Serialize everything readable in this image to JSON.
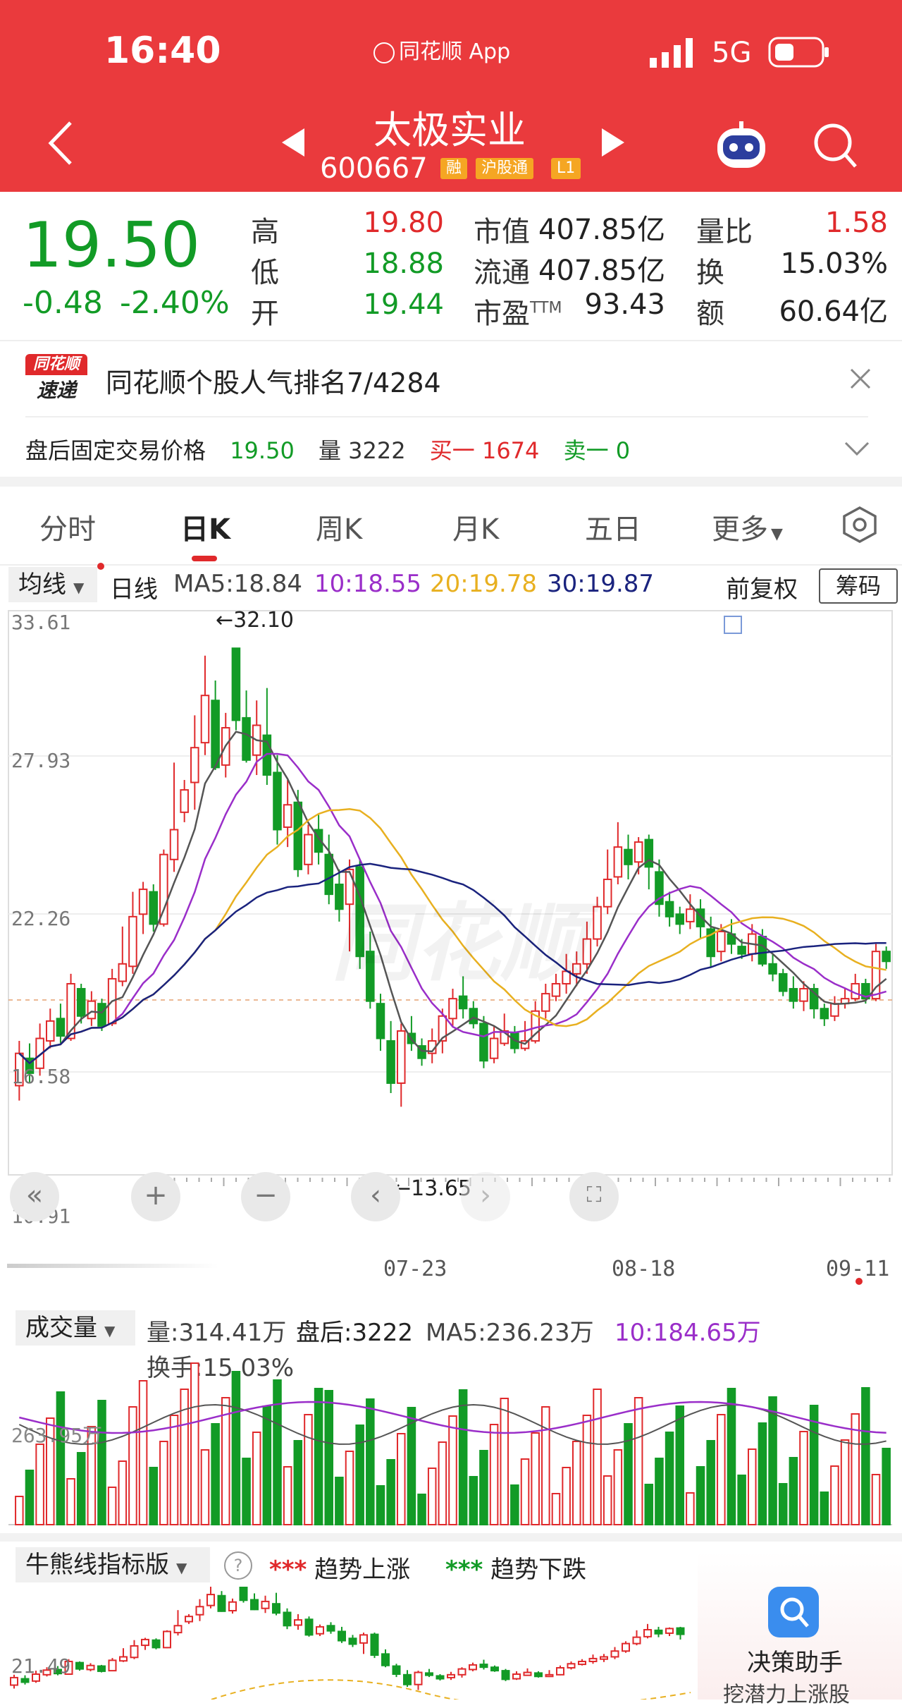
{
  "status_bar": {
    "time": "16:40",
    "app_label": "同花顺 App",
    "network": "5G"
  },
  "header": {
    "title": "太极实业",
    "code": "600667",
    "tags": [
      "融",
      "沪股通",
      "L1"
    ]
  },
  "quote": {
    "price": "19.50",
    "change": "-0.48",
    "change_pct": "-2.40%",
    "stats": [
      {
        "label": "高",
        "value": "19.80"
      },
      {
        "label": "低",
        "value": "18.88"
      },
      {
        "label": "开",
        "value": "19.44"
      },
      {
        "label": "市值",
        "value": "407.85亿"
      },
      {
        "label": "流通",
        "value": "407.85亿"
      },
      {
        "label": "市盈",
        "label_sup": "TTM",
        "value": "93.43"
      },
      {
        "label": "量比",
        "value": "1.58"
      },
      {
        "label": "换",
        "value": "15.03%"
      },
      {
        "label": "额",
        "value": "60.64亿"
      }
    ]
  },
  "news": {
    "logo_top": "同花顺",
    "logo_bottom": "速递",
    "text": "同花顺个股人气排名7/4284"
  },
  "after_hours": {
    "label": "盘后固定交易价格",
    "price": "19.50",
    "vol_label": "量",
    "vol": "3222",
    "buy_label": "买一",
    "buy": "1674",
    "sell_label": "卖一",
    "sell": "0"
  },
  "tabs": [
    "分时",
    "日K",
    "周K",
    "月K",
    "五日",
    "更多"
  ],
  "active_tab": "日K",
  "ma_bar": {
    "selector": "均线",
    "period": "日线",
    "ma5": "MA5:18.84",
    "ma10": "10:18.55",
    "ma20": "20:19.78",
    "ma30": "30:19.87",
    "adjust": "前复权",
    "chips": "筹码"
  },
  "kline": {
    "y_labels": [
      "33.61",
      "27.93",
      "22.26",
      "16.58",
      "10.91"
    ],
    "high_label": "←32.10",
    "low_label": "←13.65",
    "x_labels": [
      "07-23",
      "08-18",
      "09-11"
    ],
    "watermark": "同花顺"
  },
  "volume": {
    "selector": "成交量",
    "vol": "量:314.41万",
    "after": "盘后:3222",
    "ma5": "MA5:236.23万",
    "ma10": "10:184.65万",
    "turnover": "换手:15.03%",
    "scale": "263.95万"
  },
  "bull_bear": {
    "selector": "牛熊线指标版",
    "up": "趋势上涨",
    "down": "趋势下跌",
    "y_label": "21.49",
    "assistant": "决策助手",
    "assistant_sub": "挖潜力上涨股"
  },
  "colors": {
    "up": "#e0292b",
    "down": "#129b26",
    "ma5": "#555555",
    "ma10": "#9a2ec9",
    "ma20": "#e8b020",
    "ma30": "#1a237e",
    "header": "#ea3a3d"
  }
}
